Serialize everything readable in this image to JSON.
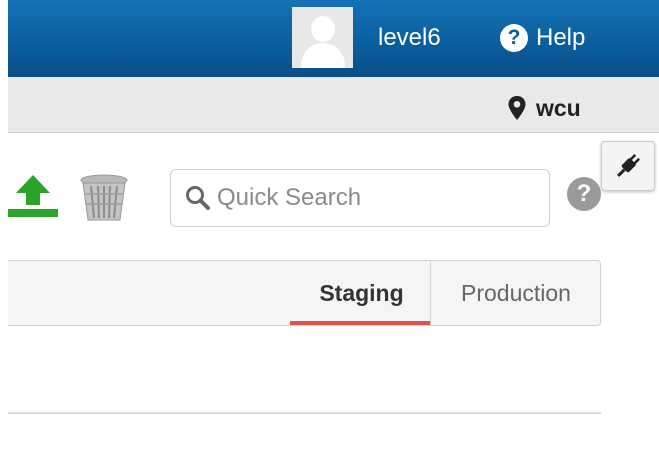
{
  "header": {
    "username": "level6",
    "help_label": "Help",
    "help_icon": "question-circle-icon",
    "avatar_icon": "user-silhouette-icon"
  },
  "location": {
    "site": "wcu",
    "icon": "map-marker-icon"
  },
  "toolbar": {
    "upload_icon": "upload-icon",
    "trash_icon": "trash-icon",
    "search_placeholder": "Quick Search",
    "search_icon": "search-icon",
    "help_icon": "question-circle-icon",
    "plugin_icon": "plug-icon"
  },
  "tabs": [
    {
      "label": "Staging",
      "active": true
    },
    {
      "label": "Production",
      "active": false
    }
  ],
  "colors": {
    "header_blue": "#0a5d9c",
    "upload_green": "#2aa52a",
    "active_tab_underline": "#d9534f"
  }
}
